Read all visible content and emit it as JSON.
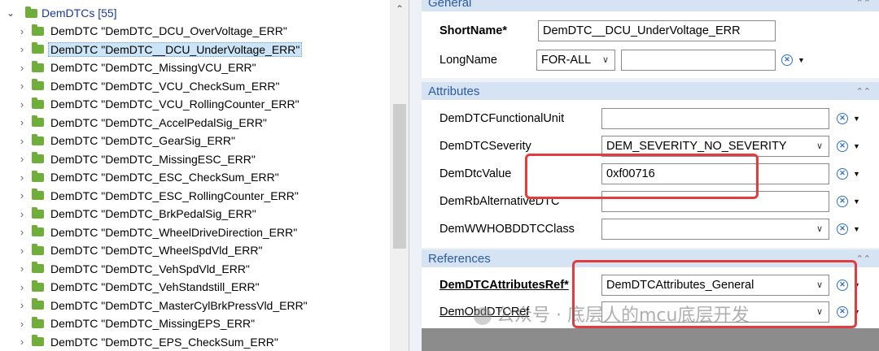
{
  "tree": {
    "root_label": "DemDTCs [55]",
    "items": [
      "DemDTC \"DemDTC_DCU_OverVoltage_ERR\"",
      "DemDTC \"DemDTC__DCU_UnderVoltage_ERR\"",
      "DemDTC \"DemDTC_MissingVCU_ERR\"",
      "DemDTC \"DemDTC_VCU_CheckSum_ERR\"",
      "DemDTC \"DemDTC_VCU_RollingCounter_ERR\"",
      "DemDTC \"DemDTC_AccelPedalSig_ERR\"",
      "DemDTC \"DemDTC_GearSig_ERR\"",
      "DemDTC \"DemDTC_MissingESC_ERR\"",
      "DemDTC \"DemDTC_ESC_CheckSum_ERR\"",
      "DemDTC \"DemDTC_ESC_RollingCounter_ERR\"",
      "DemDTC \"DemDTC_BrkPedalSig_ERR\"",
      "DemDTC \"DemDTC_WheelDriveDirection_ERR\"",
      "DemDTC \"DemDTC_WheelSpdVld_ERR\"",
      "DemDTC \"DemDTC_VehSpdVld_ERR\"",
      "DemDTC \"DemDTC_VehStandstill_ERR\"",
      "DemDTC \"DemDTC_MasterCylBrkPressVld_ERR\"",
      "DemDTC \"DemDTC_MissingEPS_ERR\"",
      "DemDTC \"DemDTC_EPS_CheckSum_ERR\""
    ],
    "selected_index": 1
  },
  "general": {
    "header": "General",
    "shortname_label": "ShortName*",
    "shortname_value": "DemDTC__DCU_UnderVoltage_ERR",
    "longname_label": "LongName",
    "longname_lang": "FOR-ALL",
    "longname_value": ""
  },
  "attributes": {
    "header": "Attributes",
    "rows": [
      {
        "label": "DemDTCFunctionalUnit",
        "value": ""
      },
      {
        "label": "DemDTCSeverity",
        "value": "DEM_SEVERITY_NO_SEVERITY"
      },
      {
        "label": "DemDtcValue",
        "value": "0xf00716"
      },
      {
        "label": "DemRbAlternativeDTC",
        "value": ""
      },
      {
        "label": "DemWWHOBDDTCClass",
        "value": ""
      }
    ]
  },
  "references": {
    "header": "References",
    "attr_ref_label": "DemDTCAttributesRef*",
    "attr_ref_value": "DemDTCAttributes_General",
    "obd_ref_label": "DemObdDTCRef",
    "obd_ref_value": ""
  },
  "watermark": "公众号 · 底层人的mcu底层开发",
  "colors": {
    "section_header_bg": "#d6e3f3",
    "section_header_text": "#2a5aa8",
    "highlight_red": "#e23c3c",
    "selection_bg": "#cce4f7",
    "folder_green": "#6fae3a"
  },
  "icons": {
    "folder": "folder-icon",
    "expand": "chevron-right-icon",
    "clear": "clear-circle-icon",
    "menu": "dropdown-triangle-icon"
  }
}
